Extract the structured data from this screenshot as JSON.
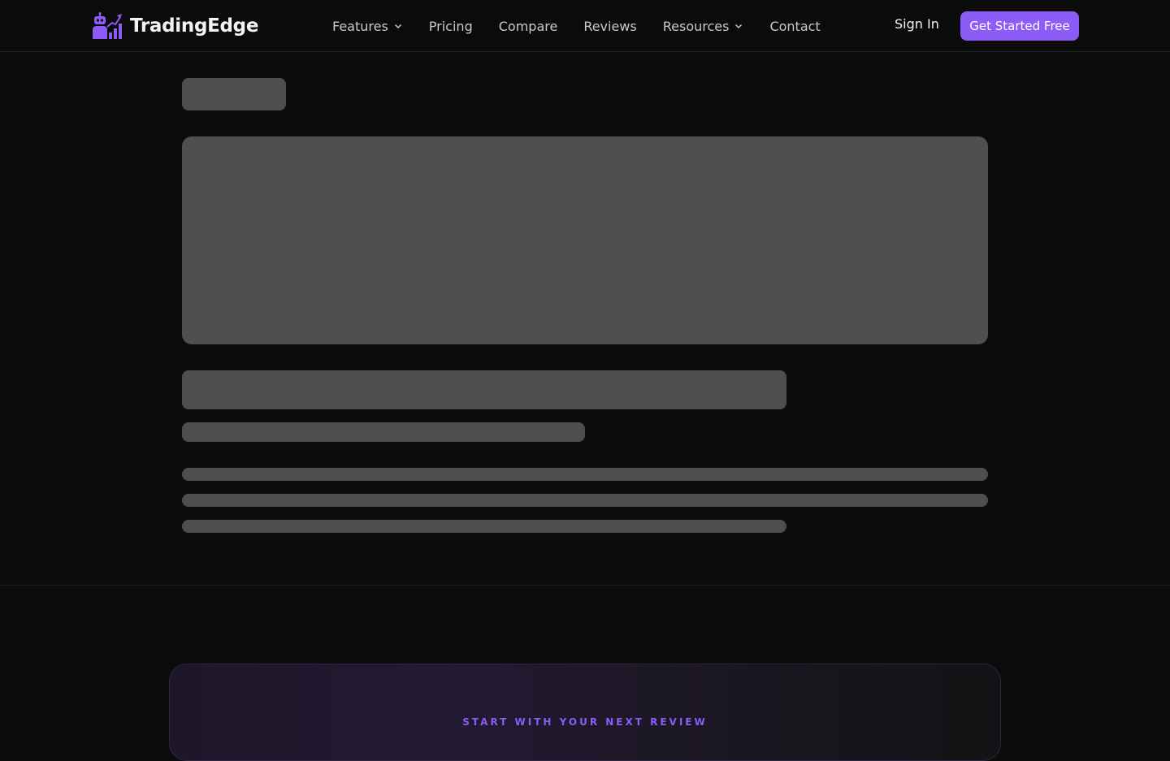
{
  "brand": {
    "name": "TradingEdge",
    "logo_icon": "robot-chart-logo-icon",
    "accent": "#8b5cf6"
  },
  "nav": {
    "links": [
      {
        "label": "Features",
        "dropdown": true
      },
      {
        "label": "Pricing",
        "dropdown": false
      },
      {
        "label": "Compare",
        "dropdown": false
      },
      {
        "label": "Reviews",
        "dropdown": false
      },
      {
        "label": "Resources",
        "dropdown": true
      },
      {
        "label": "Contact",
        "dropdown": false
      }
    ],
    "sign_in": "Sign In",
    "cta": "Get Started Free"
  },
  "cta_section": {
    "eyebrow": "START WITH YOUR NEXT REVIEW"
  },
  "colors": {
    "background": "#0b0b0b",
    "skeleton": "#4f4f4f",
    "accent": "#8b5cf6"
  }
}
